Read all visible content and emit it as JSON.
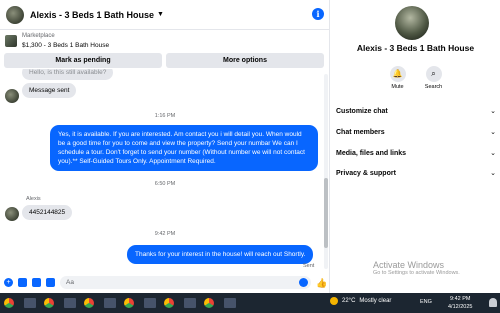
{
  "chat": {
    "title": "Alexis - 3 Beds 1 Bath House",
    "listing": {
      "category": "Marketplace",
      "name": "$1,300 - 3 Beds 1 Bath House"
    },
    "actions": {
      "mark_pending": "Mark as pending",
      "more_options": "More options"
    },
    "messages": {
      "partial_top": "Hello, is this still available?",
      "msg1": "Message sent",
      "time1": "1:16 PM",
      "msg2": "Yes, it is available. If you are interested. Am contact you i will detail you. When would be a good time for you to come and view the property? Send your numbar We can I schedule a tour. Don't forget to send your number (Without number we will not contact you).** Self-Guided Tours Only. Appointment Required.",
      "time2": "6:50 PM",
      "sender": "Alexis",
      "msg3": "4452144825",
      "time3": "9:42 PM",
      "msg4": "Thanks for your interest in the house! will reach out Shortly.",
      "status": "Sent"
    },
    "composer": {
      "placeholder": "Aa"
    }
  },
  "info": {
    "title": "Alexis - 3 Beds 1 Bath House",
    "mute": "Mute",
    "search": "Search",
    "sections": [
      "Customize chat",
      "Chat members",
      "Media, files and links",
      "Privacy & support"
    ]
  },
  "watermark": {
    "title": "Activate Windows",
    "subtitle": "Go to Settings to activate Windows."
  },
  "taskbar": {
    "weather": "22°C",
    "weather_desc": "Mostly clear",
    "lang": "ENG",
    "time": "9:42 PM",
    "date": "4/12/2025"
  },
  "colors": {
    "accent": "#0866ff",
    "bubble_in": "#e4e6eb",
    "taskbar": "#1c2631"
  }
}
